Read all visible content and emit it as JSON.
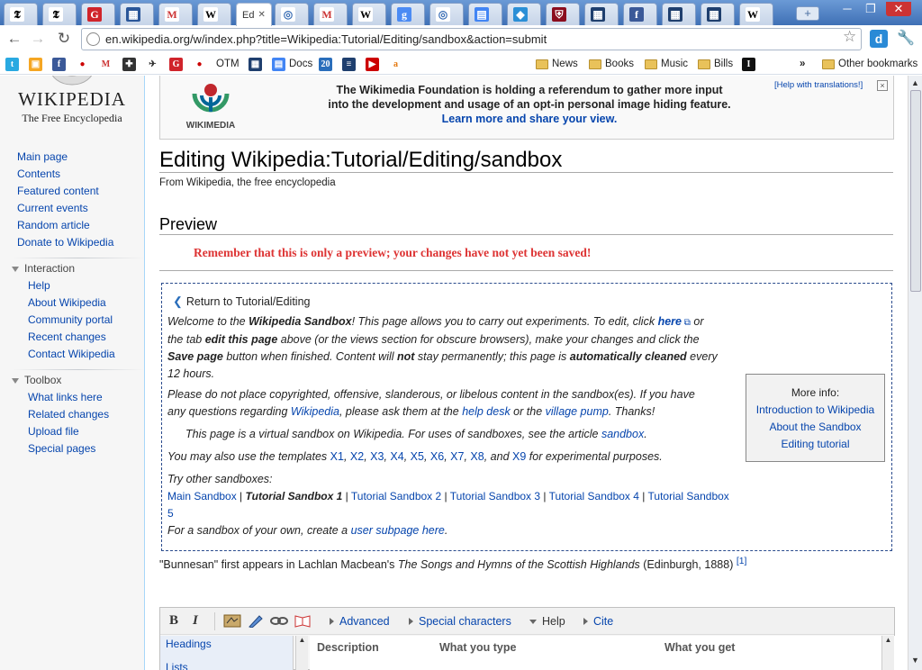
{
  "browser": {
    "tabs": [
      {
        "icon": "nyt-icon",
        "glyph": "𝕿",
        "bg": "#fff",
        "fg": "#000"
      },
      {
        "icon": "nyt-icon",
        "glyph": "𝕿",
        "bg": "#fff",
        "fg": "#000"
      },
      {
        "icon": "g-icon",
        "glyph": "G",
        "bg": "#d0242b",
        "fg": "#fff"
      },
      {
        "icon": "sheets-icon",
        "glyph": "▦",
        "bg": "#2a5699",
        "fg": "#fff"
      },
      {
        "icon": "gmail-icon",
        "glyph": "M",
        "bg": "#fff",
        "fg": "#c33"
      },
      {
        "icon": "wikipedia-icon",
        "glyph": "W",
        "bg": "#fff",
        "fg": "#000"
      },
      {
        "icon": "wikipedia-icon",
        "label": "Ed",
        "active": true
      },
      {
        "icon": "globe-icon",
        "glyph": "◎",
        "bg": "#fff",
        "fg": "#3b6fb6"
      },
      {
        "icon": "gmail-icon",
        "glyph": "M",
        "bg": "#fff",
        "fg": "#c33"
      },
      {
        "icon": "wikipedia-icon",
        "glyph": "W",
        "bg": "#fff",
        "fg": "#000"
      },
      {
        "icon": "google-icon",
        "glyph": "g",
        "bg": "#4b8bf4",
        "fg": "#fff"
      },
      {
        "icon": "globe-icon",
        "glyph": "◎",
        "bg": "#fff",
        "fg": "#3b6fb6"
      },
      {
        "icon": "doc-icon",
        "glyph": "▤",
        "bg": "#4285f4",
        "fg": "#fff"
      },
      {
        "icon": "puzzle-icon",
        "glyph": "◆",
        "bg": "#2b8fd6",
        "fg": "#fff"
      },
      {
        "icon": "shield-icon",
        "glyph": "⛨",
        "bg": "#8b0d1e",
        "fg": "#fff"
      },
      {
        "icon": "grid-icon",
        "glyph": "▦",
        "bg": "#1f3f6e",
        "fg": "#fff"
      },
      {
        "icon": "facebook-icon",
        "glyph": "f",
        "bg": "#3b5998",
        "fg": "#fff"
      },
      {
        "icon": "grid-icon",
        "glyph": "▦",
        "bg": "#1f3f6e",
        "fg": "#fff"
      },
      {
        "icon": "grid-icon",
        "glyph": "▦",
        "bg": "#1f3f6e",
        "fg": "#fff"
      },
      {
        "icon": "wikipedia-icon",
        "glyph": "W",
        "bg": "#fff",
        "fg": "#000"
      }
    ],
    "url": "en.wikipedia.org/w/index.php?title=Wikipedia:Tutorial/Editing/sandbox&action=submit",
    "bookmarks": [
      {
        "icon": "twitter-icon",
        "glyph": "t",
        "bg": "#29a9e1",
        "fg": "#fff"
      },
      {
        "icon": "photo-icon",
        "glyph": "▣",
        "bg": "#f5a623",
        "fg": "#fff"
      },
      {
        "icon": "facebook-icon",
        "glyph": "f",
        "bg": "#3b5998",
        "fg": "#fff"
      },
      {
        "icon": "record-icon",
        "glyph": "●",
        "bg": "#fff",
        "fg": "#c00"
      },
      {
        "icon": "gmail-icon",
        "glyph": "M",
        "bg": "#fff",
        "fg": "#c33"
      },
      {
        "icon": "plus-icon",
        "glyph": "✚",
        "bg": "#333",
        "fg": "#fff"
      },
      {
        "icon": "bird-icon",
        "glyph": "✈",
        "bg": "#fff",
        "fg": "#333"
      },
      {
        "icon": "g-icon",
        "glyph": "G",
        "bg": "#d0242b",
        "fg": "#fff"
      },
      {
        "icon": "record-icon",
        "glyph": "●",
        "bg": "#fff",
        "fg": "#c00"
      },
      {
        "icon": "otm-icon",
        "label": "OTM"
      },
      {
        "icon": "grid-icon",
        "glyph": "▦",
        "bg": "#1f3f6e",
        "fg": "#fff"
      },
      {
        "icon": "docs-icon",
        "glyph": "▤",
        "bg": "#4285f4",
        "fg": "#fff",
        "label": "Docs"
      },
      {
        "icon": "calendar-icon",
        "glyph": "20",
        "bg": "#2a6ebb",
        "fg": "#fff"
      },
      {
        "icon": "flag-icon",
        "glyph": "≡",
        "bg": "#1f3f6e",
        "fg": "#fff"
      },
      {
        "icon": "youtube-icon",
        "glyph": "▶",
        "bg": "#c00",
        "fg": "#fff"
      },
      {
        "icon": "amazon-icon",
        "glyph": "a",
        "bg": "#fff",
        "fg": "#e47911"
      }
    ],
    "folders": [
      "News",
      "Books",
      "Music",
      "Bills"
    ],
    "imdb": "I",
    "more": "»",
    "other_bookmarks": "Other bookmarks"
  },
  "sidebar": {
    "wordmark": "WIKIPEDIA",
    "tagline": "The Free Encyclopedia",
    "main_links": [
      "Main page",
      "Contents",
      "Featured content",
      "Current events",
      "Random article",
      "Donate to Wikipedia"
    ],
    "interaction": {
      "title": "Interaction",
      "links": [
        "Help",
        "About Wikipedia",
        "Community portal",
        "Recent changes",
        "Contact Wikipedia"
      ]
    },
    "toolbox": {
      "title": "Toolbox",
      "links": [
        "What links here",
        "Related changes",
        "Upload file",
        "Special pages"
      ]
    }
  },
  "banner": {
    "logo_text": "WIKIMEDIA",
    "line1": "The Wikimedia Foundation is holding a referendum to gather more input",
    "line2": "into the development and usage of an opt-in personal image hiding feature.",
    "link": "Learn more and share your view.",
    "help": "[Help with translations!]",
    "close": "×"
  },
  "page": {
    "title": "Editing Wikipedia:Tutorial/Editing/sandbox",
    "from": "From Wikipedia, the free encyclopedia",
    "preview_heading": "Preview",
    "preview_note": "Remember that this is only a preview; your changes have not yet been saved!",
    "return_link": "Return to Tutorial/Editing",
    "welcome_l1a": "Welcome to the ",
    "welcome_l1b": "Wikipedia Sandbox",
    "welcome_l1c": "! This page allows you to carry out experiments. To edit, click ",
    "welcome_here": "here",
    "welcome_l1d": " or",
    "welcome_l2a": "the tab ",
    "welcome_l2b": "edit this page",
    "welcome_l2c": " above (or the views section for obscure browsers), make your changes and click the",
    "welcome_l3a": "Save page",
    "welcome_l3b": " button when finished. Content will ",
    "welcome_l3c": "not",
    "welcome_l3d": " stay permanently; this page is ",
    "welcome_l3e": "automatically cleaned",
    "welcome_l3f": " every",
    "welcome_l4": "12 hours.",
    "copyright_l1": "Please do not place copyrighted, offensive, slanderous, or libelous content in the sandbox(es). If you have",
    "copyright_l2a": "any questions regarding ",
    "copyright_wp": "Wikipedia",
    "copyright_l2b": ", please ask them at the ",
    "copyright_helpdesk": "help desk",
    "copyright_l2c": " or the ",
    "copyright_pump": "village pump",
    "copyright_l2d": ". Thanks!",
    "virtual_a": "This page is a virtual sandbox on Wikipedia. For uses of sandboxes, see the article ",
    "virtual_link": "sandbox",
    "virtual_b": ".",
    "templates_a": "You may also use the templates ",
    "templates": [
      "X1",
      "X2",
      "X3",
      "X4",
      "X5",
      "X6",
      "X7",
      "X8",
      "X9"
    ],
    "templates_and": ", and ",
    "templates_b": " for experimental purposes.",
    "try_other": "Try other sandboxes:",
    "sandboxes": [
      "Main Sandbox",
      "Tutorial Sandbox 1",
      "Tutorial Sandbox 2",
      "Tutorial Sandbox 3",
      "Tutorial Sandbox 4",
      "Tutorial Sandbox"
    ],
    "sandbox5": "5",
    "own_a": "For a sandbox of your own, create a ",
    "own_link": "user subpage here",
    "own_b": ".",
    "more_info_title": "More info:",
    "more_info_links": [
      "Introduction to Wikipedia",
      "About the Sandbox",
      "Editing tutorial"
    ],
    "ref_a": "\"Bunnesan\" first appears in Lachlan Macbean's ",
    "ref_book": "The Songs and Hymns of the Scottish Highlands",
    "ref_b": " (Edinburgh, 1888)",
    "ref_sup": "[1]"
  },
  "editor": {
    "bold": "B",
    "italic": "I",
    "advanced": "Advanced",
    "special": "Special characters",
    "help": "Help",
    "cite": "Cite",
    "sections": [
      "Headings",
      "Lists"
    ],
    "columns": [
      "Description",
      "What you type",
      "What you get"
    ]
  }
}
